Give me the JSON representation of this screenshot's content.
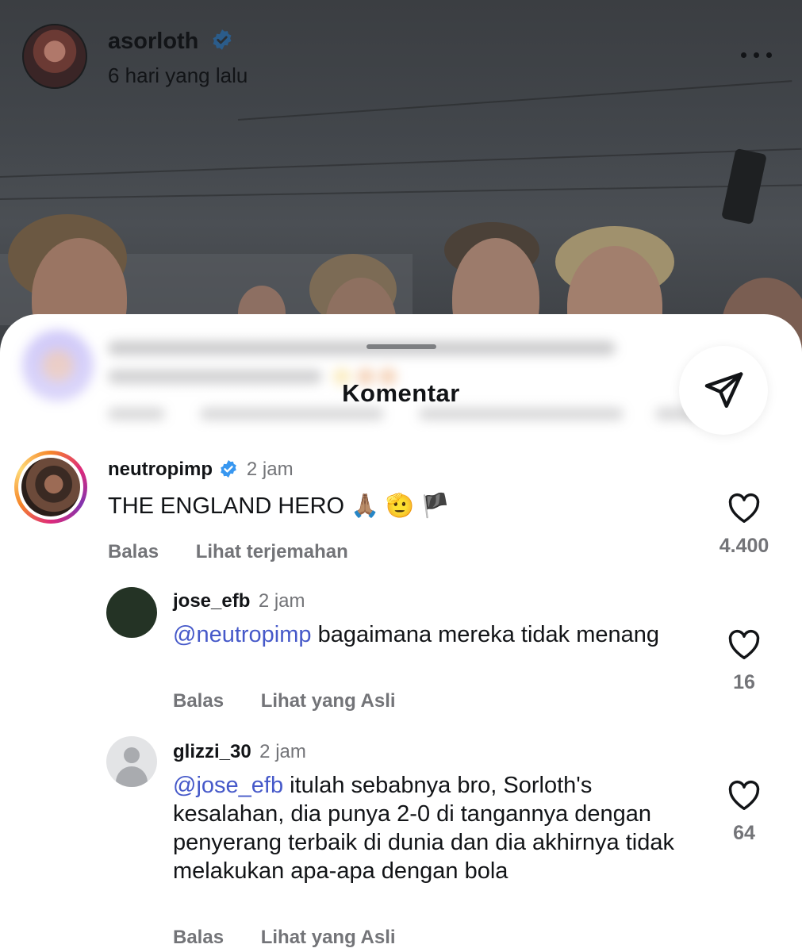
{
  "post": {
    "author": "asorloth",
    "time": "6 hari yang lalu"
  },
  "sheet": {
    "title": "Komentar",
    "blurred_actions": [
      "Balas",
      "Lihat terjemahan",
      "Bagikan di Threads"
    ]
  },
  "comments": [
    {
      "username": "neutropimp",
      "verified": true,
      "time": "2 jam",
      "mention": "",
      "text": "THE ENGLAND HERO 🙏🏽 🫡 🏴",
      "actions": [
        "Balas",
        "Lihat terjemahan"
      ],
      "likes": "4.400"
    },
    {
      "username": "jose_efb",
      "time": "2 jam",
      "mention": "@neutropimp",
      "text": " bagaimana mereka tidak menang",
      "actions": [
        "Balas",
        "Lihat yang Asli"
      ],
      "likes": "16"
    },
    {
      "username": "glizzi_30",
      "time": "2 jam",
      "mention": "@jose_efb",
      "text": " itulah sebabnya bro, Sorloth's kesalahan, dia punya 2-0 di tangannya dengan penyerang terbaik di dunia dan dia akhirnya tidak melakukan apa-apa dengan bola",
      "actions": [
        "Balas",
        "Lihat yang Asli"
      ],
      "likes": "64"
    }
  ],
  "colors": {
    "mention": "#4659c9",
    "verified": "#3897f0",
    "muted": "#737478"
  },
  "icons": [
    "verified-badge-icon",
    "more-options-icon",
    "send-icon",
    "heart-icon"
  ]
}
